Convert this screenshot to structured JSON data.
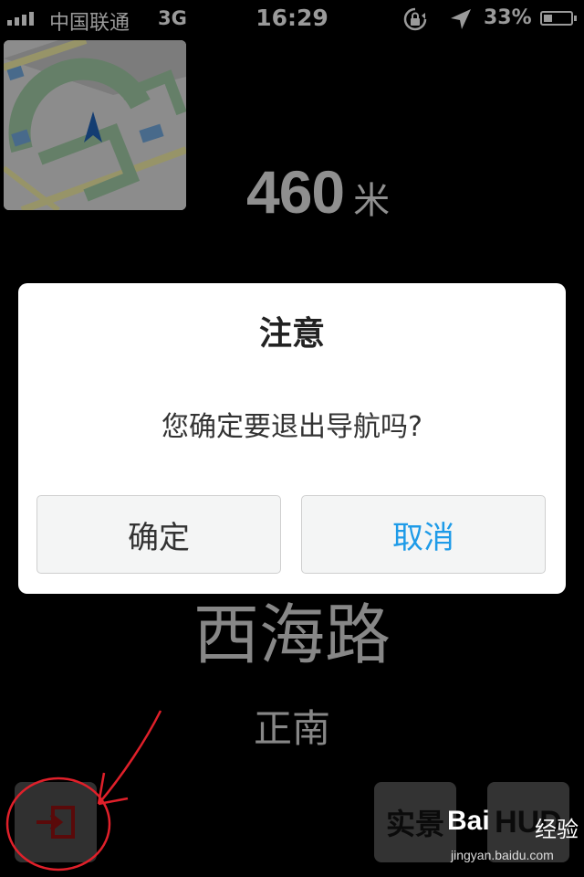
{
  "status_bar": {
    "carrier": "中国联通",
    "network": "3G",
    "time": "16:29",
    "battery": "33%",
    "battery_level": 0.33,
    "icons": [
      "signal-icon",
      "rotation-lock-icon",
      "location-arrow-icon",
      "battery-icon"
    ]
  },
  "navigation": {
    "distance_value": "460",
    "distance_unit": "米",
    "road_name": "西海路",
    "direction": "正南",
    "buttons": {
      "exit_icon": "exit-door-icon",
      "real_view": "实景",
      "hud": "HUD"
    }
  },
  "dialog": {
    "title": "注意",
    "message": "您确定要退出导航吗?",
    "confirm_label": "确定",
    "cancel_label": "取消",
    "cancel_color": "#1e9be8"
  },
  "watermark": {
    "brand": "Bai",
    "brand_suffix": "经验",
    "url": "jingyan.baidu.com"
  }
}
